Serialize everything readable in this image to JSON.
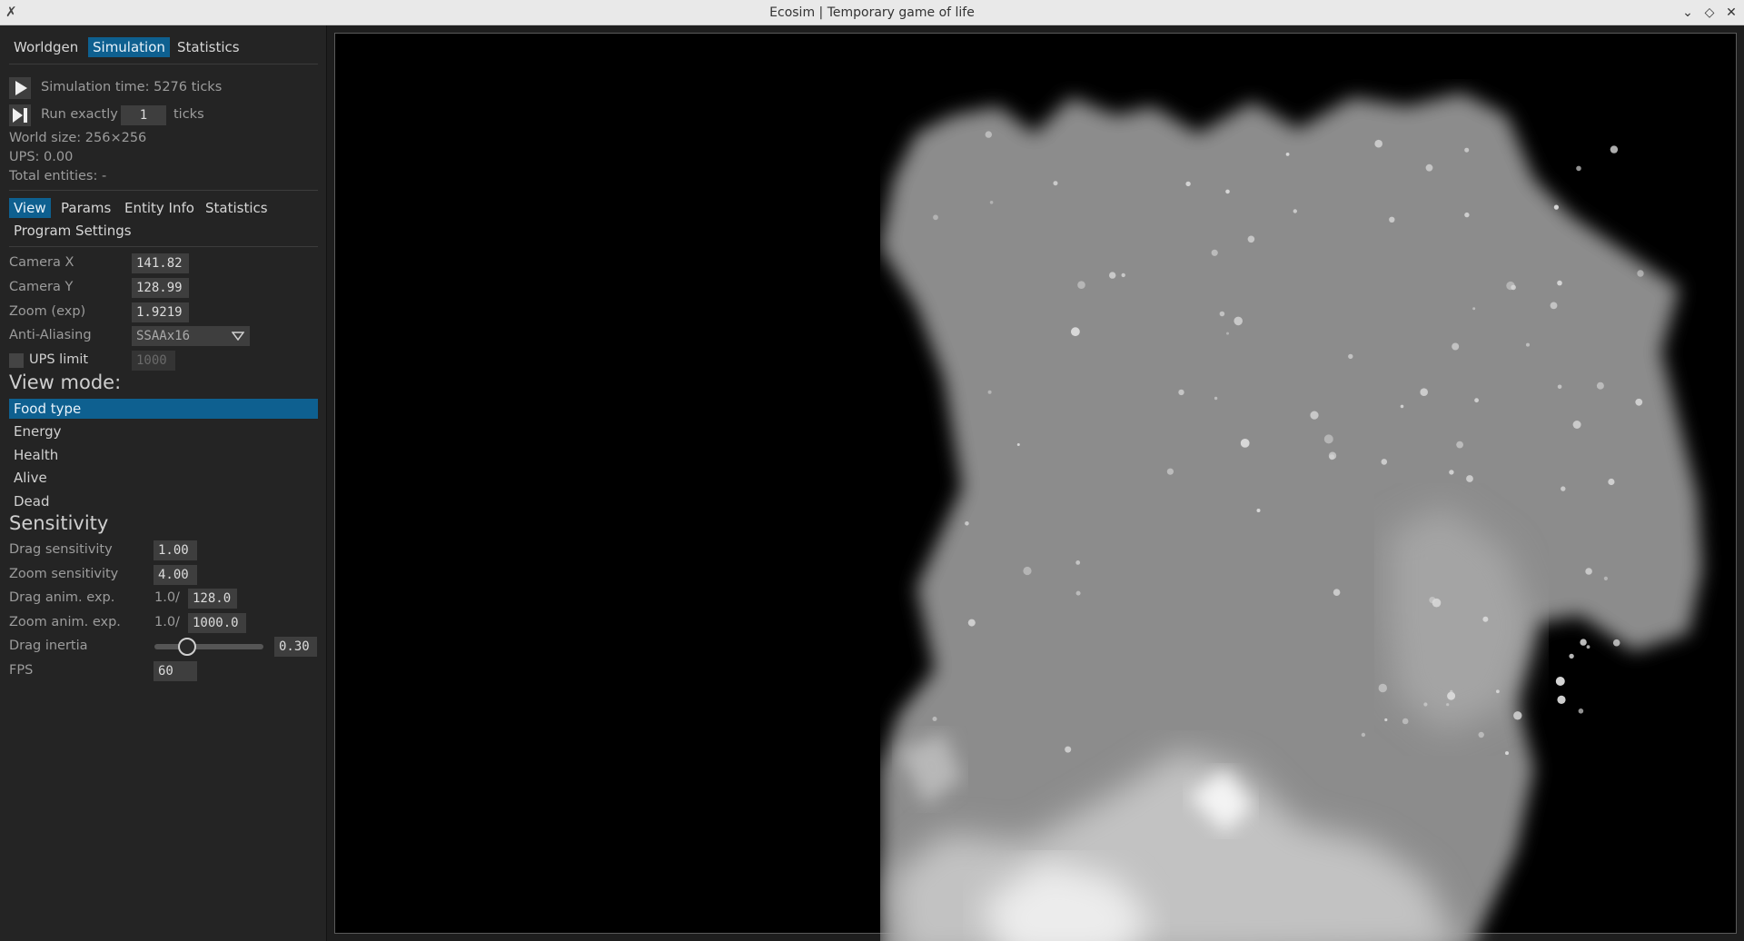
{
  "window": {
    "title": "Ecosim | Temporary game of life",
    "buttons": {
      "minimize": "⌄",
      "maximize": "◇",
      "close": "✕"
    }
  },
  "top_tabs": [
    "Worldgen",
    "Simulation",
    "Statistics"
  ],
  "top_tab_active": "Simulation",
  "sim": {
    "time_text": "Simulation time: 5276 ticks",
    "run_label": "Run exactly",
    "run_value": "1",
    "run_unit": "ticks",
    "world_size": "World size: 256×256",
    "ups": "UPS: 0.00",
    "entities": "Total entities: -"
  },
  "sub_tabs": [
    "View",
    "Params",
    "Entity Info",
    "Statistics",
    "Program Settings"
  ],
  "sub_tab_active": "View",
  "view": {
    "camera_x_label": "Camera X",
    "camera_x": "141.82",
    "camera_y_label": "Camera Y",
    "camera_y": "128.99",
    "zoom_label": "Zoom (exp)",
    "zoom": "1.9219",
    "aa_label": "Anti-Aliasing",
    "aa_value": "SSAAx16",
    "ups_limit_label": "UPS limit",
    "ups_limit": "1000",
    "ups_limit_checked": false
  },
  "view_mode": {
    "header": "View mode:",
    "items": [
      "Food type",
      "Energy",
      "Health",
      "Alive",
      "Dead"
    ],
    "selected": "Food type"
  },
  "sensitivity": {
    "header": "Sensitivity",
    "drag_label": "Drag sensitivity",
    "drag": "1.00",
    "zoom_label": "Zoom sensitivity",
    "zoom": "4.00",
    "drag_anim_label": "Drag anim. exp.",
    "drag_anim_prefix": "1.0/",
    "drag_anim": "128.0",
    "zoom_anim_label": "Zoom anim. exp.",
    "zoom_anim_prefix": "1.0/",
    "zoom_anim": "1000.0",
    "inertia_label": "Drag inertia",
    "inertia": "0.30",
    "inertia_fraction": 0.3,
    "fps_label": "FPS",
    "fps": "60"
  },
  "colors": {
    "accent": "#0e6090",
    "panel": "#242424",
    "viewport": "#000000"
  },
  "icons": {
    "play": "play-icon",
    "step": "step-icon",
    "dropdown": "triangle-down-icon",
    "app": "x11-icon"
  }
}
